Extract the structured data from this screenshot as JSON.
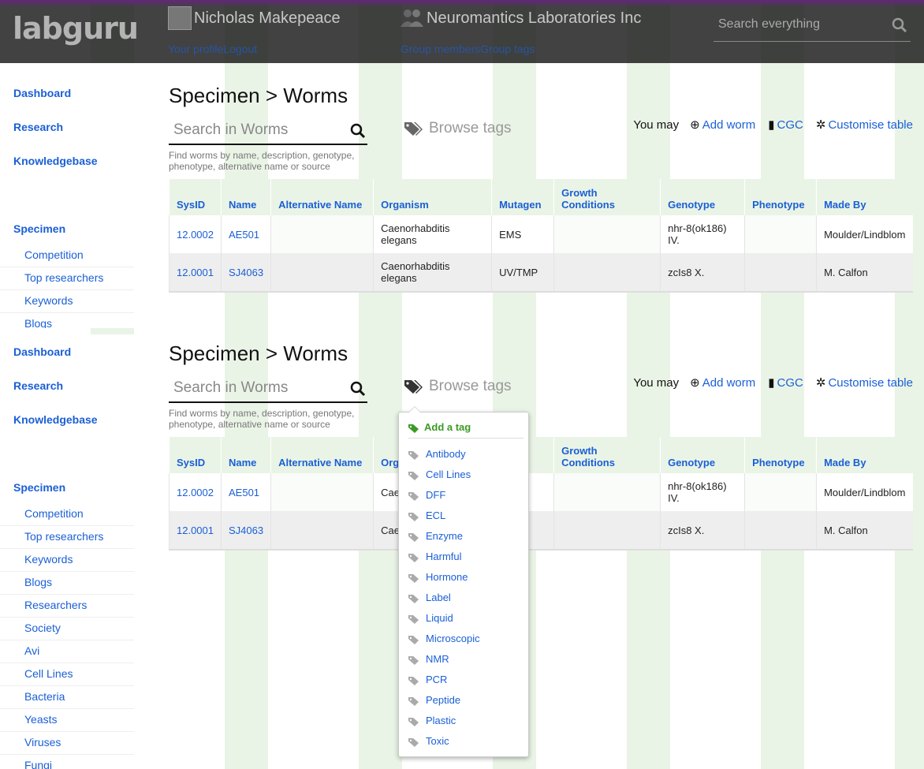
{
  "header": {
    "logo": "labguru",
    "user": {
      "name": "Nicholas Makepeace",
      "profile_link": "Your profile",
      "logout_link": "Logout"
    },
    "group": {
      "name": "Neuromantics Laboratories Inc",
      "members_link": "Group members",
      "tags_link": "Group tags"
    },
    "search_placeholder": "Search everything",
    "accent_color": "#5a2d6b"
  },
  "sidebar_top": {
    "main": [
      "Dashboard",
      "Research",
      "Knowledgebase"
    ],
    "section": "Specimen",
    "items": [
      "Competition",
      "Top researchers",
      "Keywords",
      "Blogs"
    ]
  },
  "sidebar_bottom": {
    "main": [
      "Dashboard",
      "Research",
      "Knowledgebase"
    ],
    "section": "Specimen",
    "items": [
      "Competition",
      "Top researchers",
      "Keywords",
      "Blogs",
      "Researchers",
      "Society",
      "Avi",
      "Cell Lines",
      "Bacteria",
      "Yeasts",
      "Viruses",
      "Fungi"
    ]
  },
  "page": {
    "title": "Specimen > Worms",
    "search_placeholder": "Search in Worms",
    "search_hint": "Find worms by name, description, genotype, phenotype, alternative name or source",
    "browse_tags": "Browse tags",
    "you_may": "You may",
    "add_worm": "Add worm",
    "cgc": "CGC",
    "customise": "Customise table"
  },
  "table": {
    "columns": [
      "SysID",
      "Name",
      "Alternative Name",
      "Organism",
      "Mutagen",
      "Growth Conditions",
      "Genotype",
      "Phenotype",
      "Made By"
    ],
    "rows": [
      [
        "12.0002",
        "AE501",
        "",
        "Caenorhabditis elegans",
        "EMS",
        "",
        "nhr-8(ok186) IV.",
        "",
        "Moulder/Lindblom"
      ],
      [
        "12.0001",
        "SJ4063",
        "",
        "Caenorhabditis elegans",
        "UV/TMP",
        "",
        "zcIs8 X.",
        "",
        "M. Calfon"
      ]
    ],
    "rows_obscured": [
      [
        "12.0002",
        "AE501",
        "",
        "Caen elega",
        "",
        "",
        "nhr-8(ok186) IV.",
        "",
        "Moulder/Lindblom"
      ],
      [
        "12.0001",
        "SJ4063",
        "",
        "Caen elega",
        "P",
        "",
        "zcIs8 X.",
        "",
        "M. Calfon"
      ]
    ],
    "columns_obscured_mutagen": "en"
  },
  "tag_dropdown": {
    "add_label": "Add a tag",
    "tags": [
      "Antibody",
      "Cell Lines",
      "DFF",
      "ECL",
      "Enzyme",
      "Harmful",
      "Hormone",
      "Label",
      "Liquid",
      "Microscopic",
      "NMR",
      "PCR",
      "Peptide",
      "Plastic",
      "Toxic"
    ],
    "add_color": "#3c9a23"
  }
}
